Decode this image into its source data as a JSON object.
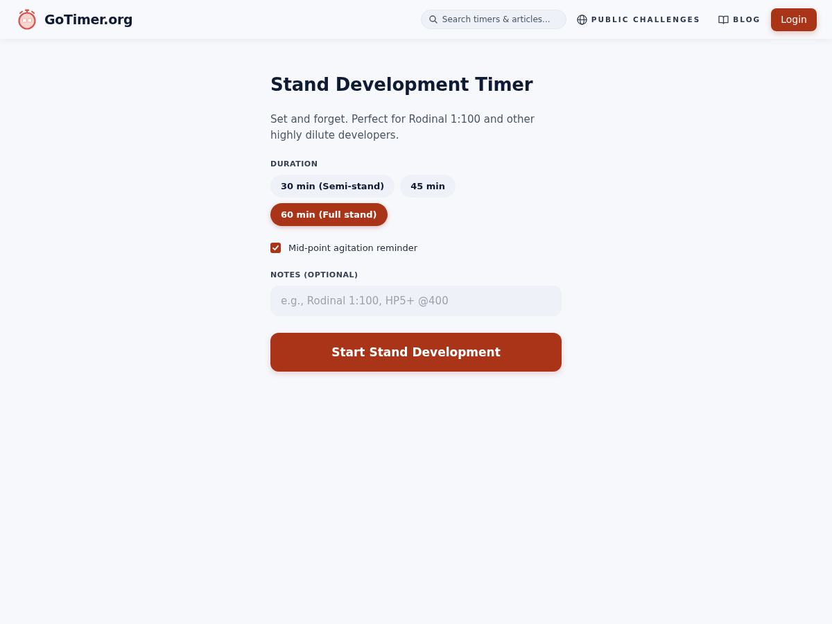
{
  "header": {
    "logo_text": "GoTimer.org",
    "search": {
      "placeholder": "Search timers & articles..."
    },
    "nav": [
      {
        "label": "PUBLIC CHALLENGES",
        "kind": "globe"
      },
      {
        "label": "BLOG",
        "kind": "book"
      }
    ],
    "login_button": "Login"
  },
  "timer": {
    "title": "Stand Development Timer",
    "description": "Set and forget. Perfect for Rodinal 1:100 and other highly dilute developers.",
    "duration": {
      "label": "DURATION",
      "options": [
        {
          "label": "30 min (Semi-stand)",
          "selected": false
        },
        {
          "label": "45 min",
          "selected": false
        },
        {
          "label": "60 min (Full stand)",
          "selected": true
        }
      ]
    },
    "agitation": {
      "label": "Mid-point agitation reminder",
      "checked": true
    },
    "notes": {
      "label": "NOTES (OPTIONAL)",
      "placeholder": "e.g., Rodinal 1:100, HP5+ @400"
    },
    "start_button": "Start Stand Development"
  }
}
